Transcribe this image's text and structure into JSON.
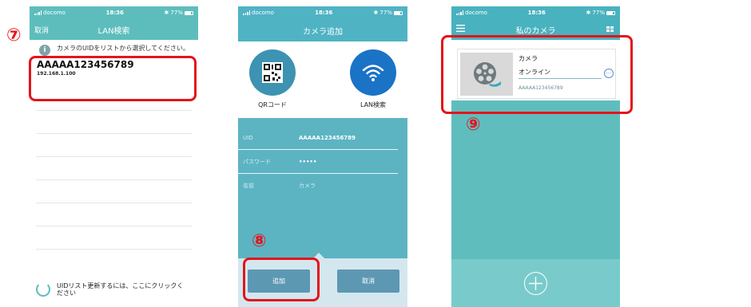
{
  "screen1": {
    "status": {
      "carrier": "docomo",
      "time": "18:36",
      "battery": "77%"
    },
    "nav": {
      "left": "取消",
      "title": "LAN検索"
    },
    "info_text": "カメラのUIDをリストから選択してください。",
    "info_icon": "i",
    "found_device": {
      "uid": "AAAAA123456789",
      "ip": "192.168.1.100"
    },
    "refresh_text": "UIDリスト更新するには、ここにクリックください"
  },
  "screen2": {
    "status": {
      "carrier": "docomo",
      "time": "18:36",
      "battery": "77%"
    },
    "nav": {
      "title": "カメラ追加"
    },
    "methods": [
      {
        "label": "QRコード",
        "icon": "qr-code-icon"
      },
      {
        "label": "LAN検索",
        "icon": "wifi-icon"
      }
    ],
    "fields": [
      {
        "label": "UID",
        "value": "AAAAA123456789"
      },
      {
        "label": "パスワード",
        "value": "•••••"
      },
      {
        "label": "名前",
        "value": "カメラ"
      }
    ],
    "buttons": {
      "add": "追加",
      "cancel": "取消"
    }
  },
  "screen3": {
    "status": {
      "carrier": "docomo",
      "time": "18:36",
      "battery": "77%"
    },
    "nav": {
      "title": "私のカメラ",
      "left_icon": "menu-icon",
      "right_icon": "grid-icon"
    },
    "camera": {
      "name": "カメラ",
      "status": "オンライン",
      "uid": "AAAAA123456789",
      "more": "···"
    },
    "add_icon": "plus-circle-icon"
  },
  "steps": {
    "s7": "⑦",
    "s8": "⑧",
    "s9": "⑨"
  },
  "colors": {
    "highlight": "#e4141b",
    "teal": "#5dbdbd",
    "blue": "#1b73c6"
  }
}
